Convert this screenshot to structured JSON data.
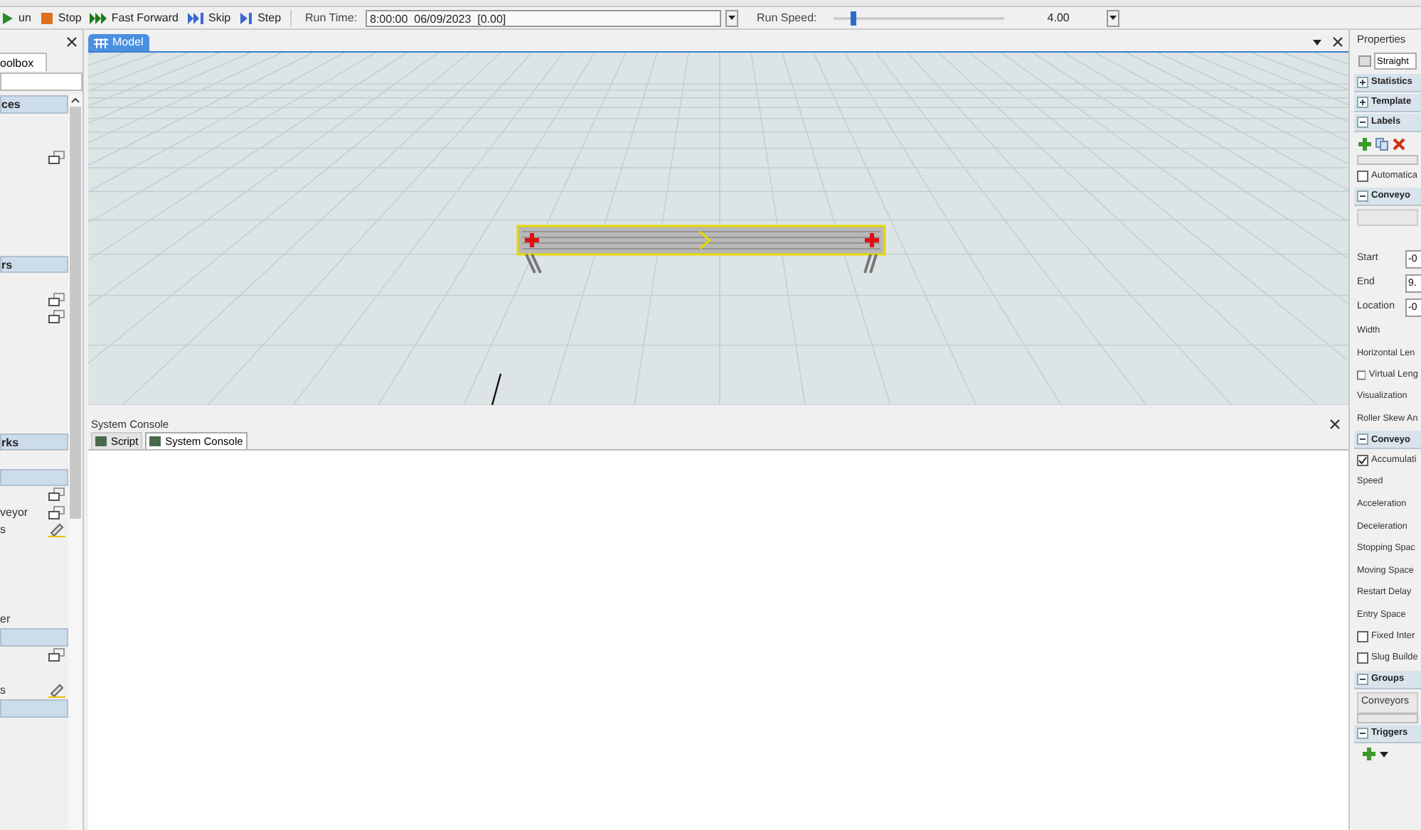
{
  "toolbar": {
    "buttons": [
      {
        "label": "un"
      },
      {
        "label": "Stop"
      },
      {
        "label": "Fast Forward"
      },
      {
        "label": "Skip"
      },
      {
        "label": "Step"
      }
    ],
    "run_time_label": "Run Time:",
    "run_time_value": "8:00:00  06/09/2023  [0.00]",
    "run_speed_label": "Run Speed:",
    "run_speed": {
      "level": 0.1,
      "reading": "4.00"
    }
  },
  "toolbox": {
    "tab": "oolbox",
    "items": [
      {
        "kind": "header",
        "label": "ces"
      },
      {
        "kind": "blank"
      },
      {
        "kind": "blank"
      },
      {
        "kind": "window"
      },
      {
        "kind": "blank"
      },
      {
        "kind": "blank"
      },
      {
        "kind": "blank"
      },
      {
        "kind": "blank"
      },
      {
        "kind": "blank"
      },
      {
        "kind": "header",
        "label": "rs"
      },
      {
        "kind": "blank"
      },
      {
        "kind": "window"
      },
      {
        "kind": "window"
      },
      {
        "kind": "blank"
      },
      {
        "kind": "blank"
      },
      {
        "kind": "blank"
      },
      {
        "kind": "blank"
      },
      {
        "kind": "blank"
      },
      {
        "kind": "blank"
      },
      {
        "kind": "header",
        "label": "rks"
      },
      {
        "kind": "blank"
      },
      {
        "kind": "header"
      },
      {
        "kind": "window"
      },
      {
        "kind": "window",
        "label": "veyor"
      },
      {
        "kind": "pencil",
        "label": "s"
      },
      {
        "kind": "blank"
      },
      {
        "kind": "blank"
      },
      {
        "kind": "blank"
      },
      {
        "kind": "blank"
      },
      {
        "kind": "text",
        "label": "er"
      },
      {
        "kind": "header"
      },
      {
        "kind": "window"
      },
      {
        "kind": "blank"
      },
      {
        "kind": "pencil",
        "label": "s"
      },
      {
        "kind": "header"
      }
    ]
  },
  "model_tab": {
    "label": "Model",
    "selected": true
  },
  "console": {
    "title": "System Console",
    "tabs": [
      {
        "label": "Script",
        "selected": false
      },
      {
        "label": "System Console",
        "selected": true
      }
    ]
  },
  "properties": {
    "title": "Properties",
    "object": "Straight",
    "rows": [
      {
        "kind": "section",
        "label": "Statistics",
        "expanded": false
      },
      {
        "kind": "section",
        "label": "Template",
        "expanded": false
      },
      {
        "kind": "section",
        "label": "Labels",
        "expanded": true
      },
      {
        "kind": "tools"
      },
      {
        "kind": "bar"
      },
      {
        "kind": "check",
        "label": "Automatica",
        "checked": false
      },
      {
        "kind": "section",
        "label": "Conveyo",
        "expanded": true
      },
      {
        "kind": "box"
      },
      {
        "kind": "gap"
      },
      {
        "kind": "field",
        "label": "Start",
        "value": "-0"
      },
      {
        "kind": "field",
        "label": "End",
        "value": "9."
      },
      {
        "kind": "field",
        "label": "Location",
        "value": "-0"
      },
      {
        "kind": "label",
        "label": "Width"
      },
      {
        "kind": "label",
        "label": "Horizontal Len"
      },
      {
        "kind": "check",
        "label": "Virtual Leng",
        "checked": false
      },
      {
        "kind": "label",
        "label": "Visualization"
      },
      {
        "kind": "label",
        "label": "Roller Skew An"
      },
      {
        "kind": "section",
        "label": "Conveyo",
        "expanded": true
      },
      {
        "kind": "check",
        "label": "Accumulati",
        "checked": true
      },
      {
        "kind": "label",
        "label": "Speed"
      },
      {
        "kind": "label",
        "label": "Acceleration"
      },
      {
        "kind": "label",
        "label": "Deceleration"
      },
      {
        "kind": "label",
        "label": "Stopping Spac"
      },
      {
        "kind": "label",
        "label": "Moving Space"
      },
      {
        "kind": "label",
        "label": "Restart Delay"
      },
      {
        "kind": "label",
        "label": "Entry Space"
      },
      {
        "kind": "check",
        "label": "Fixed Inter",
        "checked": false
      },
      {
        "kind": "check",
        "label": "Slug Builde",
        "checked": false
      },
      {
        "kind": "section",
        "label": "Groups",
        "expanded": true
      },
      {
        "kind": "list",
        "label": "Conveyors"
      },
      {
        "kind": "bar"
      },
      {
        "kind": "section",
        "label": "Triggers",
        "expanded": true
      },
      {
        "kind": "add"
      }
    ]
  }
}
